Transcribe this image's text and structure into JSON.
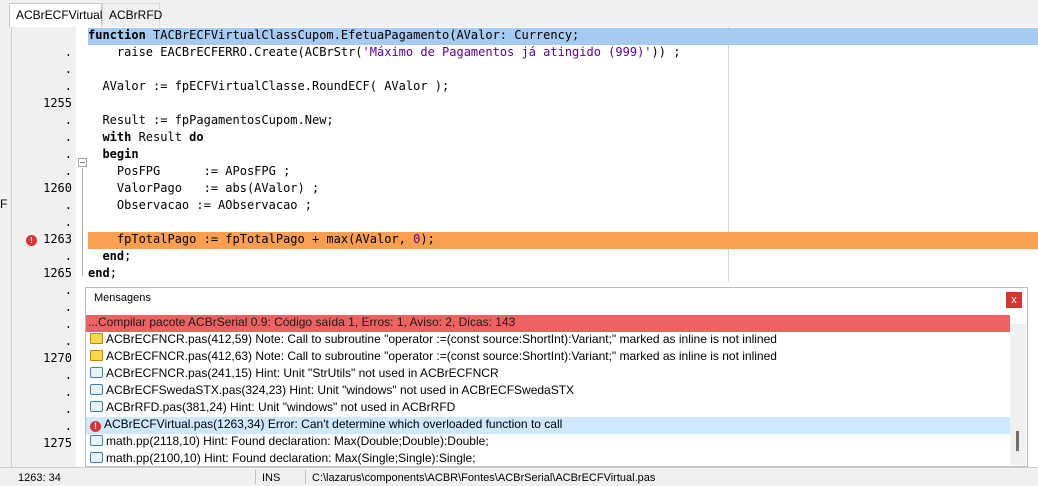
{
  "tabs": [
    {
      "label": "ACBrECFVirtual",
      "active": true
    },
    {
      "label": "ACBrRFD",
      "active": false
    }
  ],
  "left_strip_label": "F",
  "gutter": [
    {
      "text": ".",
      "row": 1
    },
    {
      "text": ".",
      "row": 2
    },
    {
      "text": ".",
      "row": 3
    },
    {
      "text": "1255",
      "row": 4
    },
    {
      "text": ".",
      "row": 5
    },
    {
      "text": ".",
      "row": 6
    },
    {
      "text": ".",
      "row": 7
    },
    {
      "text": ".",
      "row": 8
    },
    {
      "text": "1260",
      "row": 9
    },
    {
      "text": ".",
      "row": 10
    },
    {
      "text": ".",
      "row": 11
    },
    {
      "text": "1263",
      "row": 12
    },
    {
      "text": ".",
      "row": 13
    },
    {
      "text": "1265",
      "row": 14
    },
    {
      "text": ".",
      "row": 15
    },
    {
      "text": ".",
      "row": 16
    },
    {
      "text": ".",
      "row": 17
    },
    {
      "text": ".",
      "row": 18
    },
    {
      "text": "1270",
      "row": 19
    },
    {
      "text": ".",
      "row": 20
    },
    {
      "text": ".",
      "row": 21
    },
    {
      "text": ".",
      "row": 22
    },
    {
      "text": ".",
      "row": 23
    },
    {
      "text": "1275",
      "row": 24
    }
  ],
  "code": {
    "line0": [
      "function",
      " TACBrECFVirtualClassCupom.EfetuaPagamento(AValor: Currency;"
    ],
    "line1": [
      "    raise EACBrECFERRO.Create(ACBrStr(",
      "'Máximo de Pagamentos já atingido (999)'",
      ")) ;"
    ],
    "line3": [
      "  AValor := fpECFVirtualClasse.RoundECF( AValor );"
    ],
    "line5": [
      "  Result := fpPagamentosCupom.New;"
    ],
    "line6": [
      "  ",
      "with",
      " Result ",
      "do"
    ],
    "line7": [
      "  ",
      "begin"
    ],
    "line8": [
      "    PosFPG      := APosFPG ;"
    ],
    "line9": [
      "    ValorPago   := abs(AValor) ;"
    ],
    "line10": [
      "    Observacao := AObservacao ;"
    ],
    "line12": [
      "    fpTotalPago := fpTotalPago + max(AValor, ",
      "0",
      ");"
    ],
    "line13": [
      "  ",
      "end",
      ";"
    ],
    "line14": [
      "end",
      ";"
    ]
  },
  "messages": {
    "title": "Mensagens",
    "close_label": "x",
    "summary": "...Compilar pacote ACBrSerial 0.9: Código saída 1, Erros: 1, Aviso: 2, Dicas: 143",
    "items": [
      {
        "icon": "note-icon",
        "text": "ACBrECFNCR.pas(412,59) Note: Call to subroutine \"operator :=(const source:ShortInt):Variant;\" marked as inline is not inlined"
      },
      {
        "icon": "note-icon",
        "text": "ACBrECFNCR.pas(412,63) Note: Call to subroutine \"operator :=(const source:ShortInt):Variant;\" marked as inline is not inlined"
      },
      {
        "icon": "hint-icon",
        "text": "ACBrECFNCR.pas(241,15) Hint: Unit \"StrUtils\" not used in ACBrECFNCR"
      },
      {
        "icon": "hint-icon",
        "text": "ACBrECFSwedaSTX.pas(324,23) Hint: Unit \"windows\" not used in ACBrECFSwedaSTX"
      },
      {
        "icon": "hint-icon",
        "text": "ACBrRFD.pas(381,24) Hint: Unit \"windows\" not used in ACBrRFD"
      },
      {
        "icon": "error-icon",
        "text": "ACBrECFVirtual.pas(1263,34) Error: Can't determine which overloaded function to call",
        "selected": true
      },
      {
        "icon": "hint-icon",
        "text": "math.pp(2118,10) Hint: Found declaration: Max(Double;Double):Double;"
      },
      {
        "icon": "hint-icon",
        "text": "math.pp(2100,10) Hint: Found declaration: Max(Single;Single):Single;"
      }
    ]
  },
  "status": {
    "position": "1263:  34",
    "mode": "INS",
    "path": "C:\\lazarus\\components\\ACBR\\Fontes\\ACBrSerial\\ACBrECFVirtual.pas"
  },
  "colors": {
    "selected_line": "#a6caf0",
    "error_line": "#f8a050",
    "summary_bg": "#f06262",
    "selected_message": "#cde8ff"
  }
}
